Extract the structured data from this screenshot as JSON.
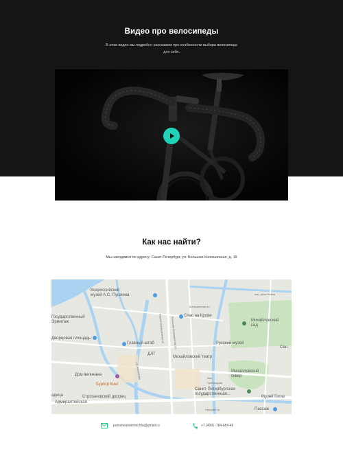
{
  "video_section": {
    "title": "Видео про велосипеды",
    "description": "В этом видео мы подробно расскажем про особенности выбора велосипеда для себя."
  },
  "location_section": {
    "title": "Как нас найти?",
    "address": "Мы находимся по адресу: Санкт-Петербург, ул. Большая Конюшенная, д. 19"
  },
  "map": {
    "labels": {
      "pushkin_museum": "Всероссийский\nмузей А.С. Пушкина",
      "state_hermitage": "Государственный\nЭрмитаж",
      "palace_square": "Дворцовая площадь",
      "main_staff": "Главный штаб",
      "dlt": "ДЛТ",
      "spas": "Спас на Крови",
      "russian_museum": "Русский музей",
      "mikhailovsky_garden": "Михайловский\nсад",
      "mikhailovsky_theatre": "Михайловский театр",
      "mikhailovsky_square": "Михайловский\nсквер",
      "singer_house": "Дом велнкана",
      "burger_king": "Бургер Кинг",
      "stroganov": "Строгановский дворец",
      "admiralty": "Адмиралтейская",
      "philharmonic": "Санкт-Петербургская\nгосударственная...",
      "hygiene_museum": "Музей Гигие",
      "passage": "Пассаж",
      "griboedova": "Кан.\nГрибоедова",
      "nevsky": "Невский пр",
      "naberezhnaya": "нас. реки Мойки",
      "konyushennaya": "Конюшенная пл.",
      "bolshaya_konyushennaya": "Большая Конюшенная ул.",
      "malaya_konyushennaya": "Малая Конюшенная ул.",
      "ul_zhelyabova": "ул. Желябова",
      "left_edge_1": "адица",
      "right_edge_1": "Сен"
    }
  },
  "contacts": {
    "email": "putosheatviemechta@gmail.ru",
    "phone": "+7 (499) -784-684-46",
    "email_icon": "mail-icon",
    "phone_icon": "phone-icon"
  },
  "colors": {
    "dark_band": "#151515",
    "accent": "#1fd3b9",
    "water": "#aad3f2",
    "park": "#c9e3bf",
    "icon_green": "#2fc98e"
  }
}
